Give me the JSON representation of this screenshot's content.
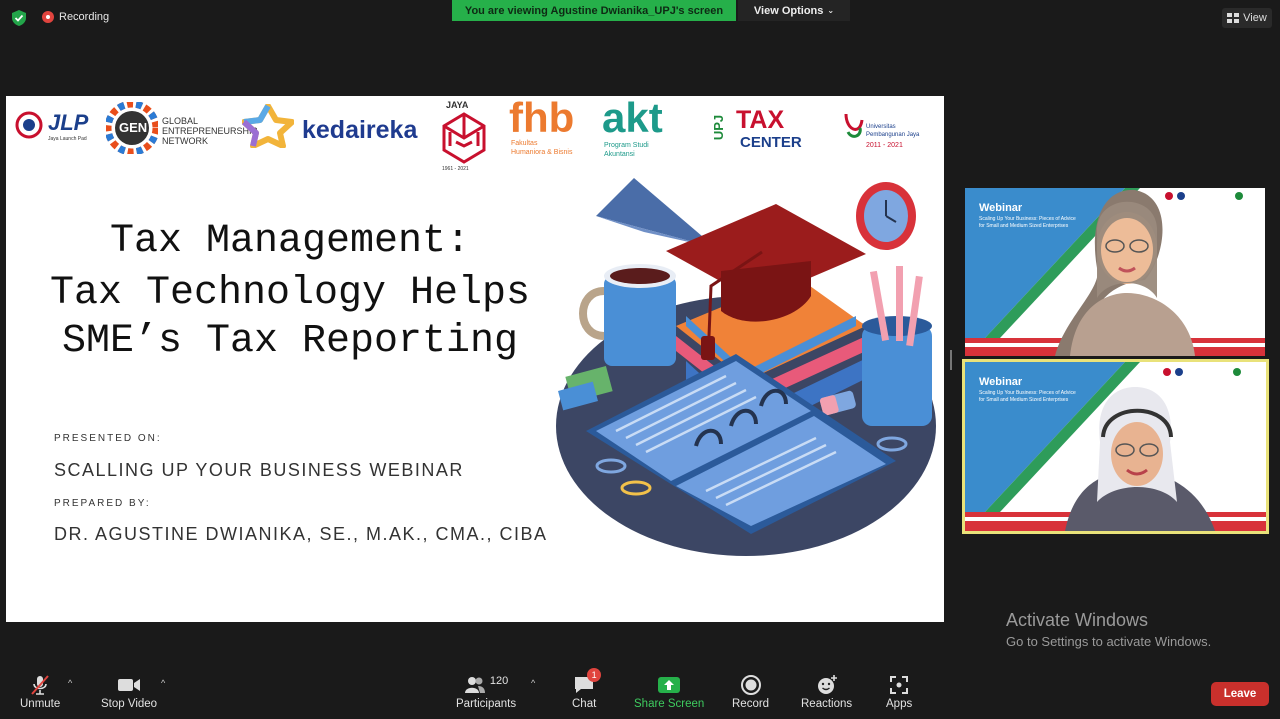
{
  "topbar": {
    "recording_label": "Recording",
    "viewing_banner": "You are viewing Agustine Dwianika_UPJ's screen",
    "view_options_label": "View Options",
    "view_label": "View",
    "banner_color": "#26b04a"
  },
  "slide": {
    "logos": {
      "jlp": "JLP",
      "jlp_sub": "Jaya Launch Pad",
      "gen": "GEN",
      "gen_text1": "GLOBAL",
      "gen_text2": "ENTREPRENEURSHIP",
      "gen_text3": "NETWORK",
      "kedaireka": "kedaireka",
      "jaya": "JAYA",
      "jaya_years": "1961 - 2021",
      "fhb": "fhb",
      "fhb_sub1": "Fakultas",
      "fhb_sub2": "Humaniora & Bisnis",
      "akt": "akt",
      "akt_sub1": "Program Studi",
      "akt_sub2": "Akuntansi",
      "upj": "UPJ",
      "tax": "TAX",
      "center": "CENTER",
      "univ1": "Universitas",
      "univ2": "Pembangunan Jaya",
      "univ_years": "2011 - 2021"
    },
    "title_line1": "Tax Management:",
    "title_line2": "Tax Technology Helps",
    "title_line3": "SME’s Tax Reporting",
    "presented_on_label": "PRESENTED ON:",
    "presented_on_value": "SCALLING UP YOUR BUSINESS WEBINAR",
    "prepared_by_label": "PREPARED BY:",
    "prepared_by_value": "DR. AGUSTINE DWIANIKA, SE., M.AK., CMA., CIBA"
  },
  "tiles": [
    {
      "webinar": "Webinar",
      "subtitle1": "Scaling Up Your Business: Pieces of Advice",
      "subtitle2": "for Small and Medium Sized Enterprises"
    },
    {
      "webinar": "Webinar",
      "subtitle1": "Scaling Up Your Business: Pieces of Advice",
      "subtitle2": "for Small and Medium Sized Enterprises"
    }
  ],
  "watermark": {
    "line1": "Activate Windows",
    "line2": "Go to Settings to activate Windows."
  },
  "toolbar": {
    "unmute": "Unmute",
    "stop_video": "Stop Video",
    "participants": "Participants",
    "participants_count": "120",
    "chat": "Chat",
    "chat_badge": "1",
    "share_screen": "Share Screen",
    "record": "Record",
    "reactions": "Reactions",
    "apps": "Apps",
    "leave": "Leave",
    "share_color": "#26b04a",
    "leave_color": "#c9302c"
  }
}
